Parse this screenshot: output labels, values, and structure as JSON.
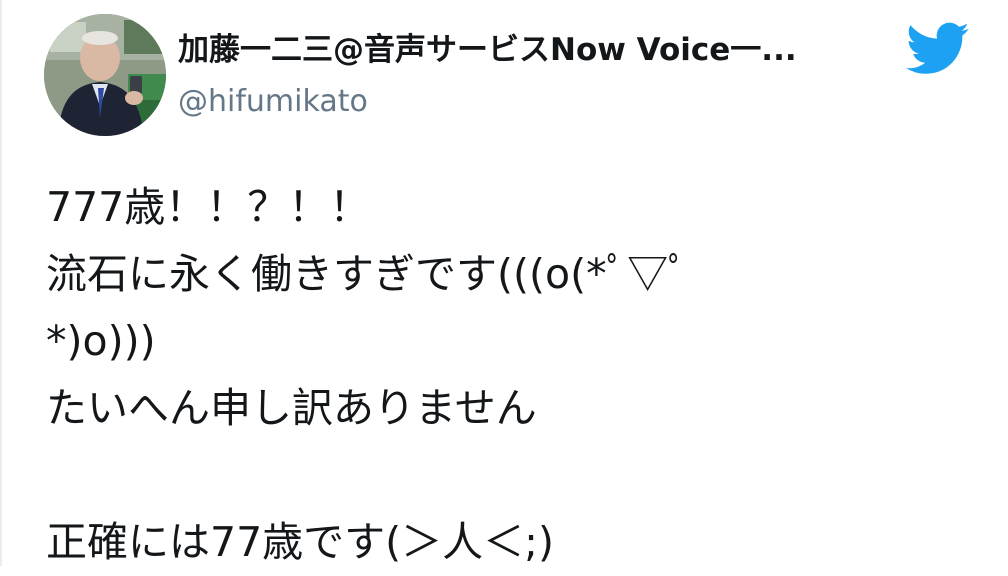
{
  "author": {
    "name": "加藤一二三@音声サービスNow Voice一...",
    "handle": "@hifumikato",
    "avatar_icon": "profile-photo-avatar"
  },
  "brand": {
    "icon": "twitter-bird-icon",
    "color": "#1da1f2"
  },
  "tweet": {
    "lines": [
      "777歳！！？！！",
      "流石に永く働きすぎです(((o(*ﾟ▽ﾟ",
      "*)o)))",
      "たいへん申し訳ありません",
      "",
      "正確には77歳です(＞人＜;)"
    ]
  },
  "colors": {
    "text": "#14171a",
    "secondary_text": "#657786",
    "background": "#ffffff"
  }
}
